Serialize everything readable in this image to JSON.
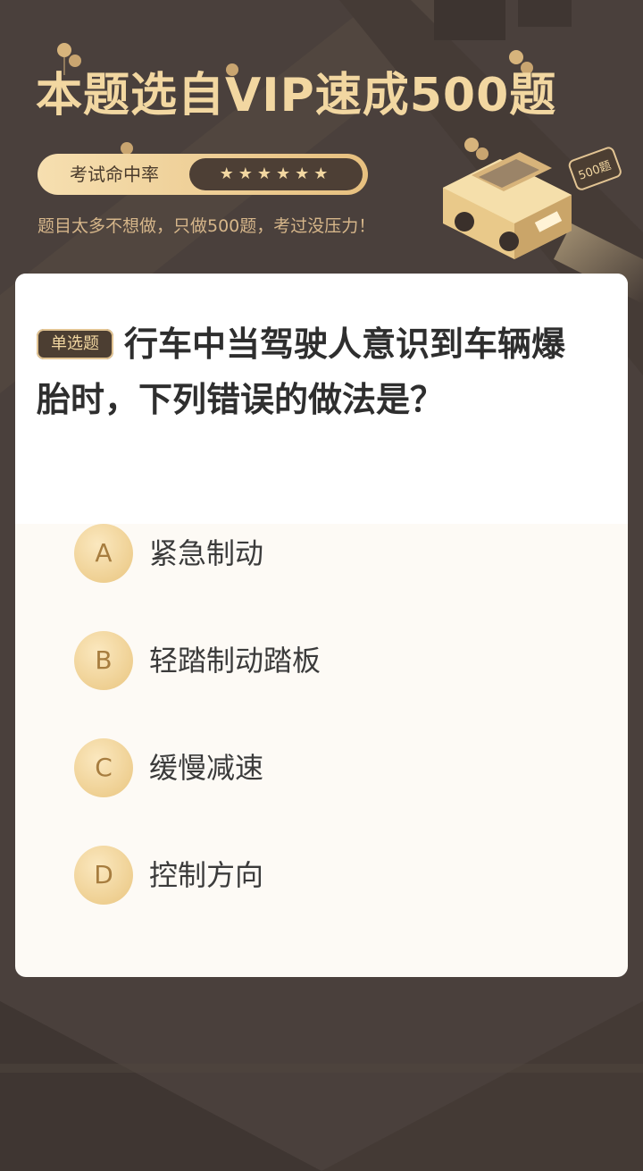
{
  "header": {
    "title": "本题选自VIP速成500题",
    "rate_label": "考试命中率",
    "rate_stars": "★★★★★★",
    "subtitle": "题目太多不想做，只做500题，考过没压力！",
    "car_sign": "500题"
  },
  "question": {
    "type_badge": "单选题",
    "text": "行车中当驾驶人意识到车辆爆胎时，下列错误的做法是？",
    "options": [
      {
        "letter": "A",
        "text": "紧急制动"
      },
      {
        "letter": "B",
        "text": "轻踏制动踏板"
      },
      {
        "letter": "C",
        "text": "缓慢减速"
      },
      {
        "letter": "D",
        "text": "控制方向"
      }
    ]
  },
  "colors": {
    "background": "#4a403c",
    "gold": "#f2d7a1",
    "badge_bg": "#4c3e32",
    "option_circle": "#e9c57f"
  }
}
